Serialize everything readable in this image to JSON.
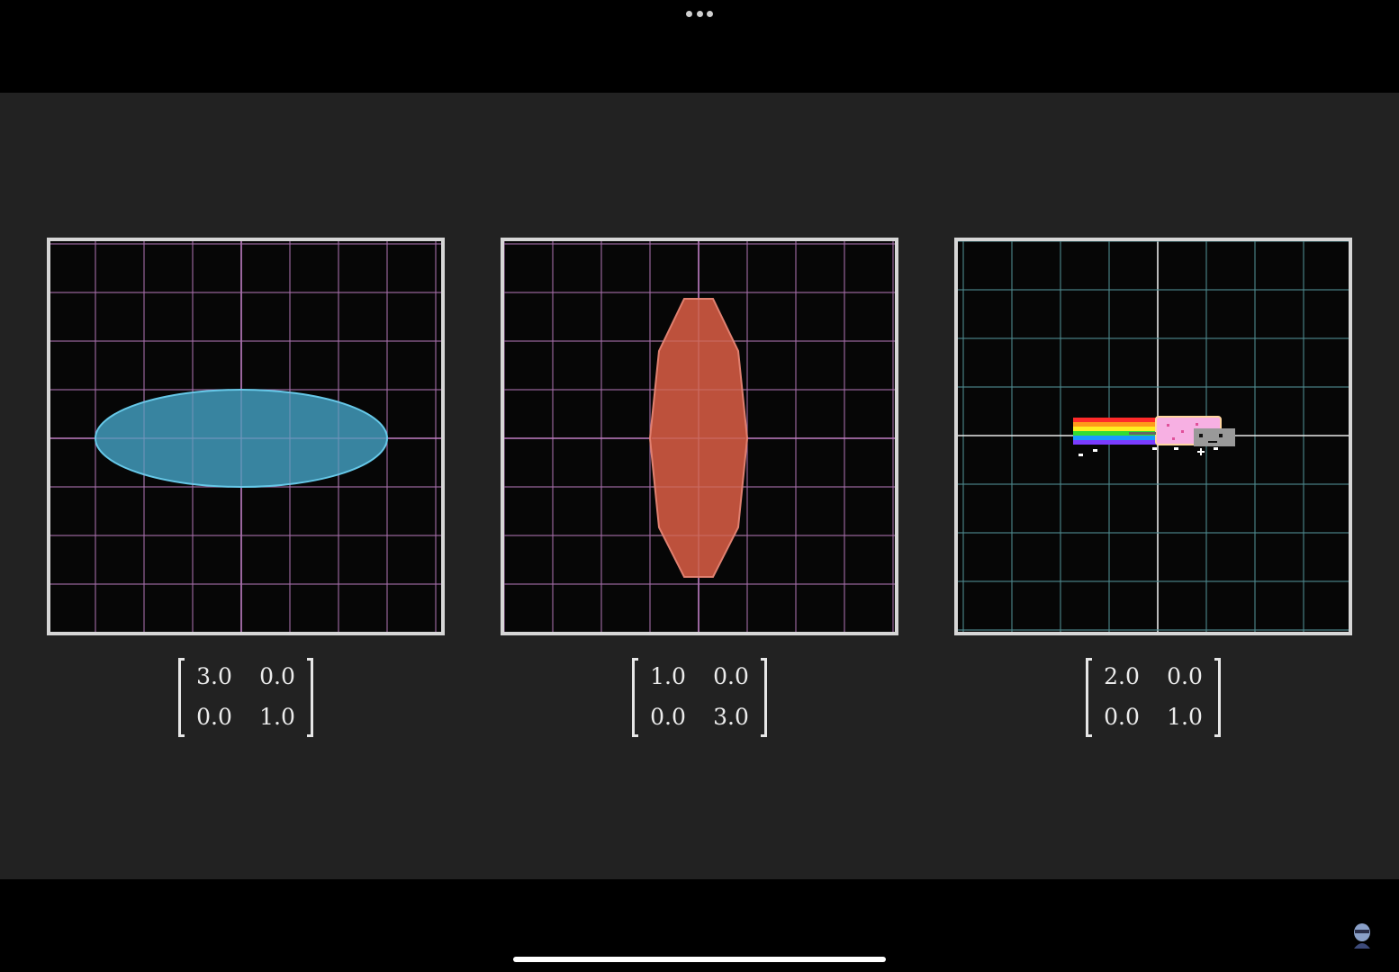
{
  "window": {
    "menu_icon": "more-dots-icon",
    "home_indicator": "home-indicator-bar",
    "avatar_icon": "profile-avatar-icon"
  },
  "panels": [
    {
      "shape": "ellipse",
      "fill": "#3d8fae",
      "stroke": "#66c8e8",
      "grid_color": "#a56fa8",
      "matrix": {
        "a": "3.0",
        "b": "0.0",
        "c": "0.0",
        "d": "1.0"
      }
    },
    {
      "shape": "polygon",
      "fill": "#c7553f",
      "stroke": "#e08070",
      "grid_color": "#a56fa8",
      "matrix": {
        "a": "1.0",
        "b": "0.0",
        "c": "0.0",
        "d": "3.0"
      }
    },
    {
      "shape": "nyan-cat",
      "fill": "#f7b0e3",
      "stroke": "#ffffff",
      "grid_color": "#4f8a8f",
      "matrix": {
        "a": "2.0",
        "b": "0.0",
        "c": "0.0",
        "d": "1.0"
      }
    }
  ],
  "colors": {
    "video_background": "#222222",
    "frame_border": "#d6d6d6",
    "plot_background": "#060606"
  }
}
